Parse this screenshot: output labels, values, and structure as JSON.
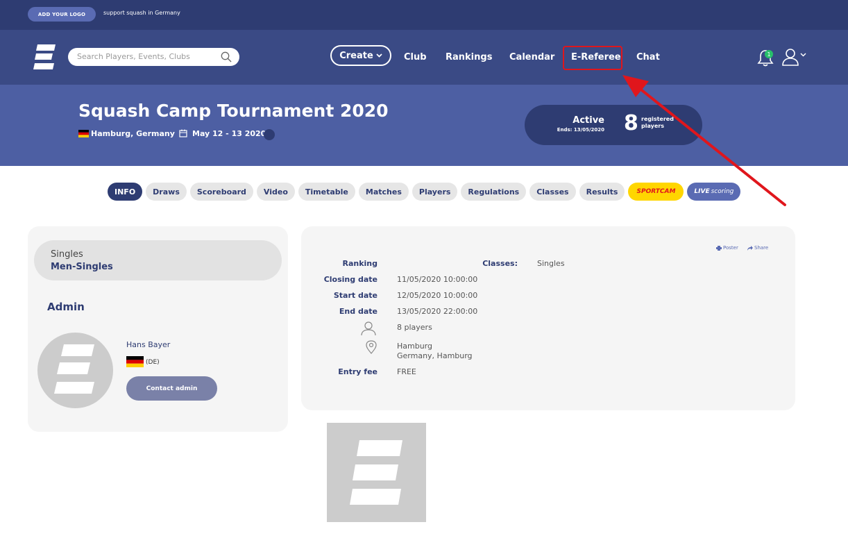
{
  "topbar": {
    "logo_button": "ADD YOUR LOGO",
    "tagline": "support squash in Germany"
  },
  "nav": {
    "search_placeholder": "Search Players, Events, Clubs",
    "create_label": "Create",
    "items": [
      "Club",
      "Rankings",
      "Calendar",
      "E-Referee",
      "Chat"
    ],
    "notification_count": "1",
    "highlight_color": "#e0161c"
  },
  "event": {
    "title": "Squash Camp Tournament 2020",
    "location": "Hamburg, Germany",
    "dates": "May 12 - 13 2020",
    "status": "Active",
    "ends": "Ends: 13/05/2020",
    "registered_count": "8",
    "registered_label_1": "registered",
    "registered_label_2": "players"
  },
  "tabs": {
    "items": [
      "INFO",
      "Draws",
      "Scoreboard",
      "Video",
      "Timetable",
      "Matches",
      "Players",
      "Regulations",
      "Classes",
      "Results"
    ],
    "sportcam_label": "SPORTCAM",
    "live_label_bold": "LIVE",
    "live_label_rest": "scoring",
    "active": "INFO"
  },
  "sidebar": {
    "class_type": "Singles",
    "class_name": "Men-Singles",
    "admin_heading": "Admin",
    "admin_name": "Hans Bayer",
    "admin_country": "(DE)",
    "contact_label": "Contact admin"
  },
  "details": {
    "poster_label": "Poster",
    "share_label": "Share",
    "ranking_label": "Ranking",
    "closing_label": "Closing date",
    "closing_value": "11/05/2020 10:00:00",
    "start_label": "Start date",
    "start_value": "12/05/2020 10:00:00",
    "end_label": "End date",
    "end_value": "13/05/2020 22:00:00",
    "players_value": "8 players",
    "location_line1": "Hamburg",
    "location_line2": "Germany, Hamburg",
    "fee_label": "Entry fee",
    "fee_value": "FREE",
    "classes_label": "Classes:",
    "classes_value": "Singles"
  },
  "colors": {
    "primary_dark": "#2e3c72",
    "nav_bg": "#3a4a85",
    "hero_bg": "#4d5fa3",
    "accent_red": "#e0161c",
    "sportcam_yellow": "#ffd600",
    "badge_green": "#27c06a"
  }
}
